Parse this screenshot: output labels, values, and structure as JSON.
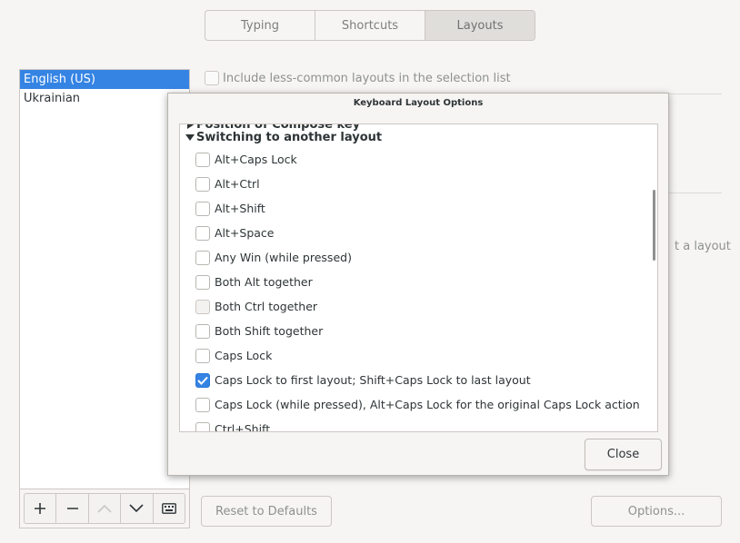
{
  "tabs": [
    "Typing",
    "Shortcuts",
    "Layouts"
  ],
  "active_tab_index": 2,
  "layouts": {
    "items": [
      "English (US)",
      "Ukrainian"
    ],
    "selected_index": 0
  },
  "include_less_common_label": "Include less-common layouts in the selection list",
  "background_partial_text": "t a layout",
  "reset_button_label": "Reset to Defaults",
  "options_button_label": "Options...",
  "dialog": {
    "title": "Keyboard Layout Options",
    "collapsed_group": "Position of Compose key",
    "expanded_group": "Switching to another layout",
    "options": [
      {
        "label": "Alt+Caps Lock",
        "checked": false
      },
      {
        "label": "Alt+Ctrl",
        "checked": false
      },
      {
        "label": "Alt+Shift",
        "checked": false
      },
      {
        "label": "Alt+Space",
        "checked": false
      },
      {
        "label": "Any Win (while pressed)",
        "checked": false
      },
      {
        "label": "Both Alt together",
        "checked": false
      },
      {
        "label": "Both Ctrl together",
        "checked": false
      },
      {
        "label": "Both Shift together",
        "checked": false
      },
      {
        "label": "Caps Lock",
        "checked": false
      },
      {
        "label": "Caps Lock to first layout; Shift+Caps Lock to last layout",
        "checked": true
      },
      {
        "label": "Caps Lock (while pressed), Alt+Caps Lock for the original Caps Lock action",
        "checked": false
      },
      {
        "label": "Ctrl+Shift",
        "checked": false
      }
    ],
    "close_label": "Close"
  },
  "colors": {
    "accent": "#3584e4",
    "window_bg": "#f6f5f4",
    "border": "#cdc7c2"
  },
  "icons": {
    "list_toolbar": [
      "plus-icon",
      "minus-icon",
      "up-arrow-icon",
      "down-arrow-icon",
      "keyboard-icon"
    ]
  }
}
